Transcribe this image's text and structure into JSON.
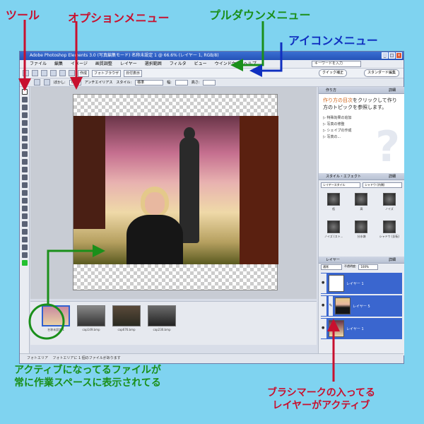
{
  "annotations": {
    "tools": "ツール",
    "options_menu": "オプションメニュー",
    "pulldown_menu": "プルダウンメニュー",
    "icon_menu": "アイコンメニュー",
    "active_file_line1": "アクティブになってるファイルが",
    "active_file_line2": "常に作業スペースに表示されてる",
    "active_layer_line1": "ブラシマークの入ってる",
    "active_layer_line2": "レイヤーがアクティブ"
  },
  "window": {
    "title": "Adobe Photoshop Elements 3.0 (写真編集モード) 名称未設定 1 @ 66.6% (レイヤー 1, RGB/8)"
  },
  "menubar": {
    "items": [
      "ファイル",
      "編集",
      "イメージ",
      "画質調整",
      "レイヤー",
      "選択範囲",
      "フィルタ",
      "ビュー",
      "ウインドウ",
      "ヘルプ"
    ],
    "search_placeholder": "キーワードを入力"
  },
  "iconbar": {
    "create": "作成",
    "photo_browser": "フォトブラウザ",
    "date_view": "日付表示",
    "quick_fix": "クイック補正",
    "standard_edit": "スタンダード編集"
  },
  "optbar": {
    "feather_label": "ぼかし:",
    "feather_value": "0 px",
    "antialias": "アンチエイリアス",
    "style_label": "スタイル:",
    "style_value": "標準",
    "width_label": "幅:",
    "height_label": "高さ:"
  },
  "project_bin": {
    "thumbs": [
      {
        "caption": "名称未設定 1"
      },
      {
        "caption": "cap149.bmp"
      },
      {
        "caption": "cap676.bmp"
      },
      {
        "caption": "cap230.bmp"
      }
    ]
  },
  "statusbar": {
    "text": "フォトエリア",
    "hint": "フォトエリアに 1 個のファイルがあります"
  },
  "panels": {
    "howto": {
      "title": "作り方",
      "detail": "詳細",
      "lead_hl": "作り方の目次",
      "lead": "をクリックして作り方のトピックを参照します。",
      "items": [
        "特殊効果の追加",
        "写真の修整",
        "シェイプの作成",
        "写真の..."
      ]
    },
    "styles": {
      "title": "スタイル・エフェクト",
      "detail": "詳細",
      "category": "レイヤースタイル",
      "subcategory": "シャドウ (内側)",
      "swatches": [
        "低",
        "高",
        "ノイズ",
        "ノイズ (スト...",
        "分水嶺",
        "シャドウ (反転)"
      ]
    },
    "layers": {
      "title": "レイヤー",
      "detail": "詳細",
      "mode": "通常",
      "opacity_label": "不透明度:",
      "opacity": "100%",
      "rows": [
        {
          "name": "レイヤー 1"
        },
        {
          "name": "レイヤー 5"
        },
        {
          "name": "レイヤー 1"
        }
      ]
    }
  },
  "colors": {
    "background": "#7fd3f0",
    "annotation_red": "#c8102e",
    "annotation_green": "#1a8f1a",
    "annotation_blue": "#1030c0",
    "layer_active": "#3a66cf"
  }
}
